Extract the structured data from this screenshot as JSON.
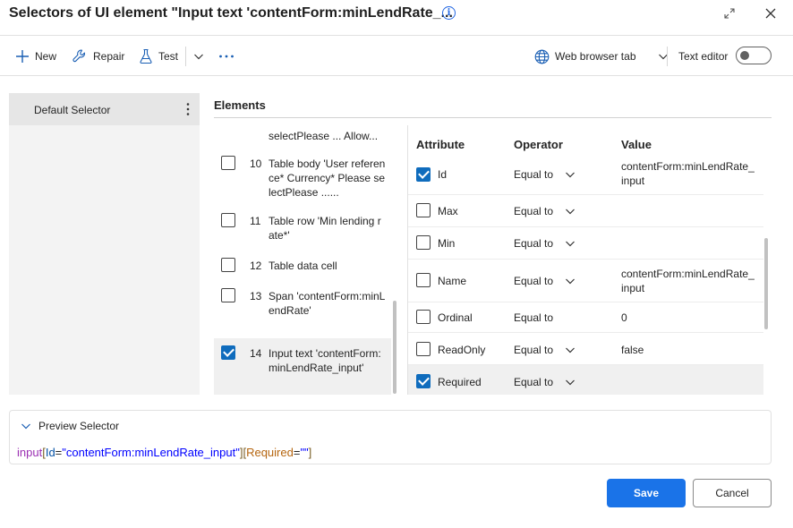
{
  "window": {
    "title": "Selectors of UI element \"Input text 'contentForm:minLendRate_...",
    "info_icon": "info-icon",
    "expand_icon": "expand-icon",
    "close_icon": "close-icon"
  },
  "toolbar": {
    "new_label": "New",
    "repair_label": "Repair",
    "test_label": "Test",
    "more_icon": "ellipsis-icon",
    "browser_label": "Web browser tab",
    "text_editor_label": "Text editor",
    "text_editor_on": false
  },
  "selectors": {
    "items": [
      {
        "label": "Default Selector",
        "selected": true
      }
    ]
  },
  "elements": {
    "heading": "Elements",
    "items": [
      {
        "num": "",
        "text": "selectPlease ... Allow...",
        "checked": false,
        "partial": true
      },
      {
        "num": "10",
        "text": "Table body 'User reference* Currency* Please selectPlease ......",
        "checked": false
      },
      {
        "num": "11",
        "text": "Table row 'Min lending rate*'",
        "checked": false
      },
      {
        "num": "12",
        "text": "Table data cell",
        "checked": false
      },
      {
        "num": "13",
        "text": "Span 'contentForm:minLendRate'",
        "checked": false
      },
      {
        "num": "14",
        "text": "Input text 'contentForm:minLendRate_input'",
        "checked": true,
        "selected": true
      }
    ]
  },
  "attributes": {
    "headers": {
      "attribute": "Attribute",
      "operator": "Operator",
      "value": "Value"
    },
    "rows": [
      {
        "name": "Id",
        "checked": true,
        "operator": "Equal to",
        "has_dropdown": true,
        "value": "contentForm:minLendRate_input"
      },
      {
        "name": "Max",
        "checked": false,
        "operator": "Equal to",
        "has_dropdown": true,
        "value": ""
      },
      {
        "name": "Min",
        "checked": false,
        "operator": "Equal to",
        "has_dropdown": true,
        "value": ""
      },
      {
        "name": "Name",
        "checked": false,
        "operator": "Equal to",
        "has_dropdown": true,
        "value": "contentForm:minLendRate_input"
      },
      {
        "name": "Ordinal",
        "checked": false,
        "operator": "Equal to",
        "has_dropdown": false,
        "value": "0"
      },
      {
        "name": "ReadOnly",
        "checked": false,
        "operator": "Equal to",
        "has_dropdown": true,
        "value": "false"
      },
      {
        "name": "Required",
        "checked": true,
        "operator": "Equal to",
        "has_dropdown": true,
        "value": "",
        "selected": true
      }
    ]
  },
  "preview": {
    "label": "Preview Selector",
    "code": {
      "tag": "input",
      "open1": "[",
      "attr1": "Id",
      "eq1": "=",
      "val1": "\"contentForm:minLendRate_input\"",
      "close1": "]",
      "open2": "[",
      "attr2": "Required",
      "eq2": "=",
      "val2": "\"\"",
      "close2": "]"
    }
  },
  "footer": {
    "save_label": "Save",
    "cancel_label": "Cancel"
  },
  "colors": {
    "accent": "#1a73e8",
    "checkbox_checked": "#0f6cbd"
  }
}
